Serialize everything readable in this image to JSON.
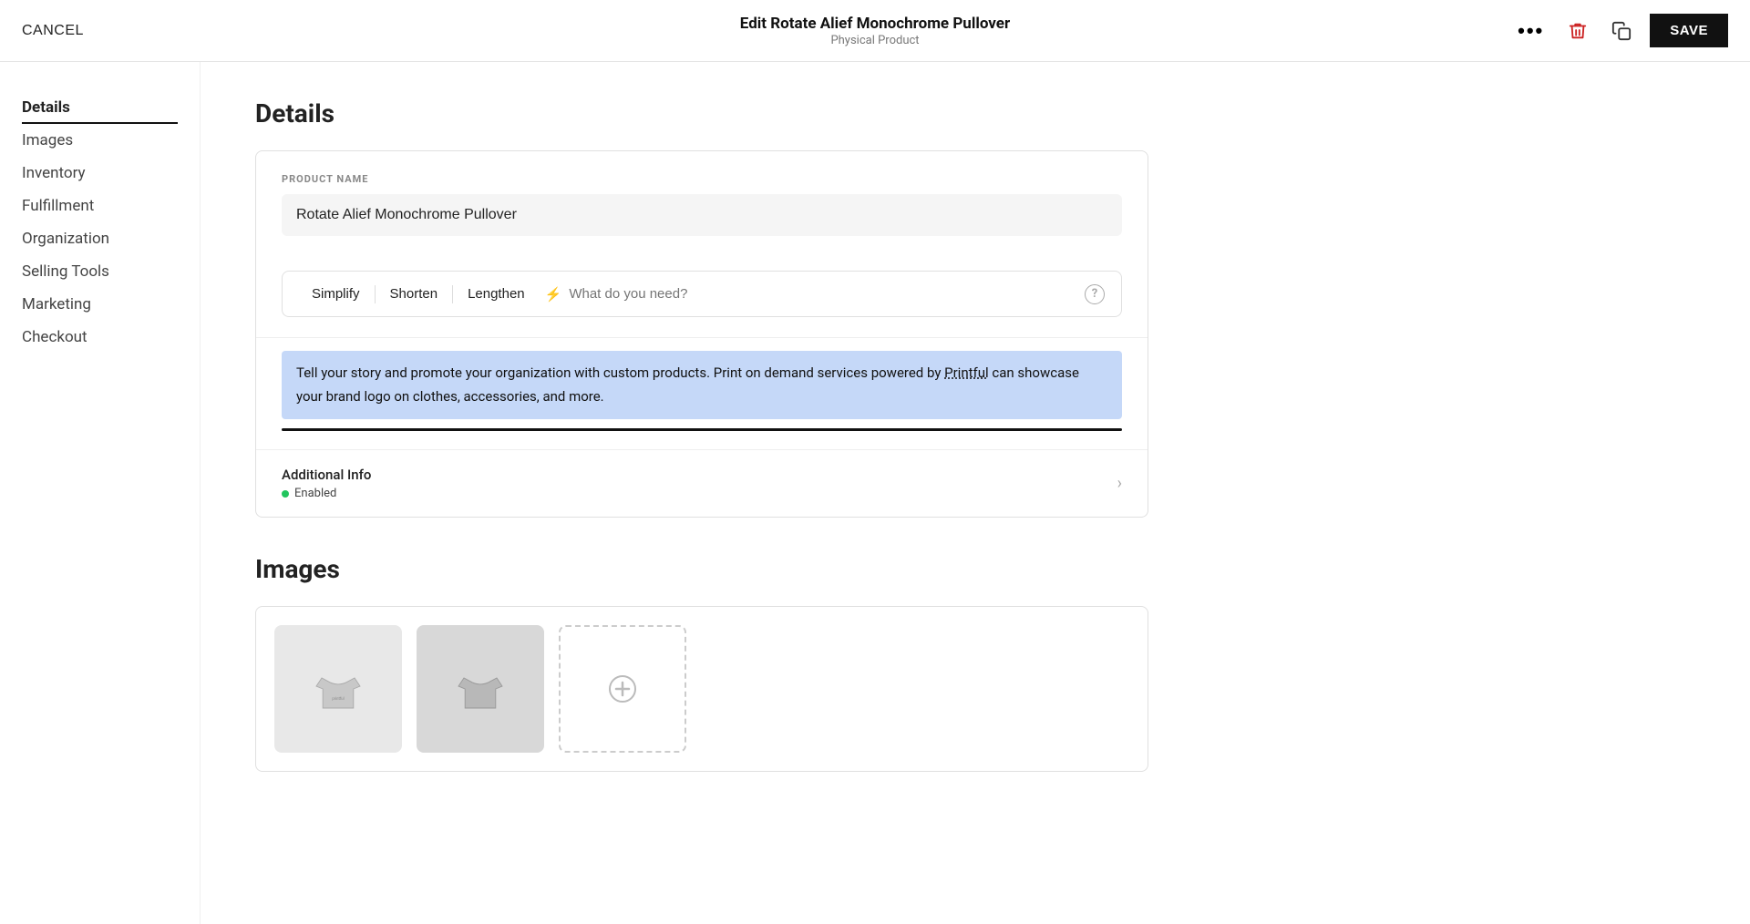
{
  "topbar": {
    "cancel_label": "CANCEL",
    "title": "Edit Rotate Alief Monochrome Pullover",
    "subtitle": "Physical Product",
    "save_label": "SAVE"
  },
  "sidebar": {
    "items": [
      {
        "id": "details",
        "label": "Details",
        "active": true
      },
      {
        "id": "images",
        "label": "Images",
        "active": false
      },
      {
        "id": "inventory",
        "label": "Inventory",
        "active": false
      },
      {
        "id": "fulfillment",
        "label": "Fulfillment",
        "active": false
      },
      {
        "id": "organization",
        "label": "Organization",
        "active": false
      },
      {
        "id": "selling-tools",
        "label": "Selling Tools",
        "active": false
      },
      {
        "id": "marketing",
        "label": "Marketing",
        "active": false
      },
      {
        "id": "checkout",
        "label": "Checkout",
        "active": false
      }
    ]
  },
  "details_section": {
    "title": "Details",
    "product_name_label": "PRODUCT NAME",
    "product_name_value": "Rotate Alief Monochrome Pullover"
  },
  "ai_toolbar": {
    "simplify_label": "Simplify",
    "shorten_label": "Shorten",
    "lengthen_label": "Lengthen",
    "input_placeholder": "What do you need?",
    "help_label": "?"
  },
  "description": {
    "text": "Tell your story and promote your organization with custom products. Print on demand services powered by Printful can showcase your brand logo on clothes, accessories, and more.",
    "underlined_word": "Printful"
  },
  "additional_info": {
    "title": "Additional Info",
    "status_label": "Enabled"
  },
  "images_section": {
    "title": "Images"
  },
  "icons": {
    "more": "···",
    "delete": "🗑",
    "duplicate": "⧉",
    "lightning": "⚡",
    "help": "?",
    "chevron_right": "›",
    "plus": "+"
  }
}
